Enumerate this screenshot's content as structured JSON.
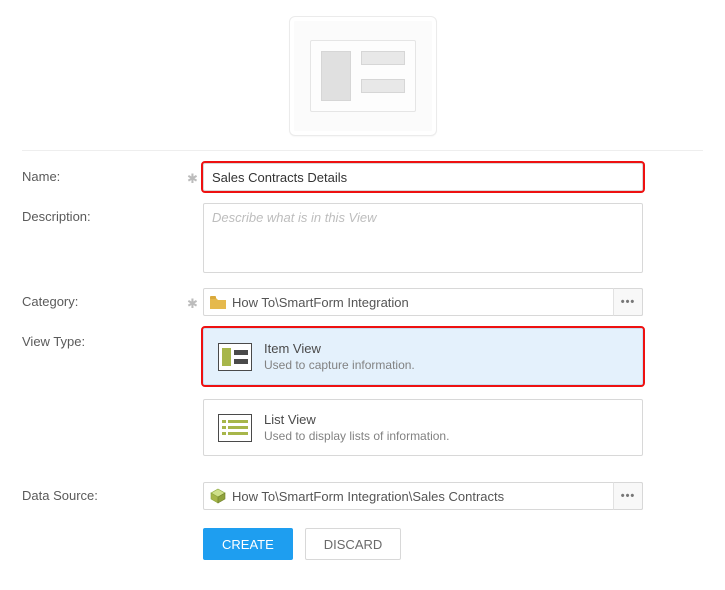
{
  "labels": {
    "name": "Name:",
    "description": "Description:",
    "category": "Category:",
    "viewType": "View Type:",
    "dataSource": "Data Source:"
  },
  "name": {
    "value": "Sales Contracts Details"
  },
  "description": {
    "placeholder": "Describe what is in this View",
    "value": ""
  },
  "category": {
    "path": "How To\\SmartForm Integration"
  },
  "viewTypes": {
    "item": {
      "title": "Item View",
      "subtitle": "Used to capture information."
    },
    "list": {
      "title": "List View",
      "subtitle": "Used to display lists of information."
    }
  },
  "dataSource": {
    "path": "How To\\SmartForm Integration\\Sales Contracts"
  },
  "buttons": {
    "create": "CREATE",
    "discard": "DISCARD"
  }
}
